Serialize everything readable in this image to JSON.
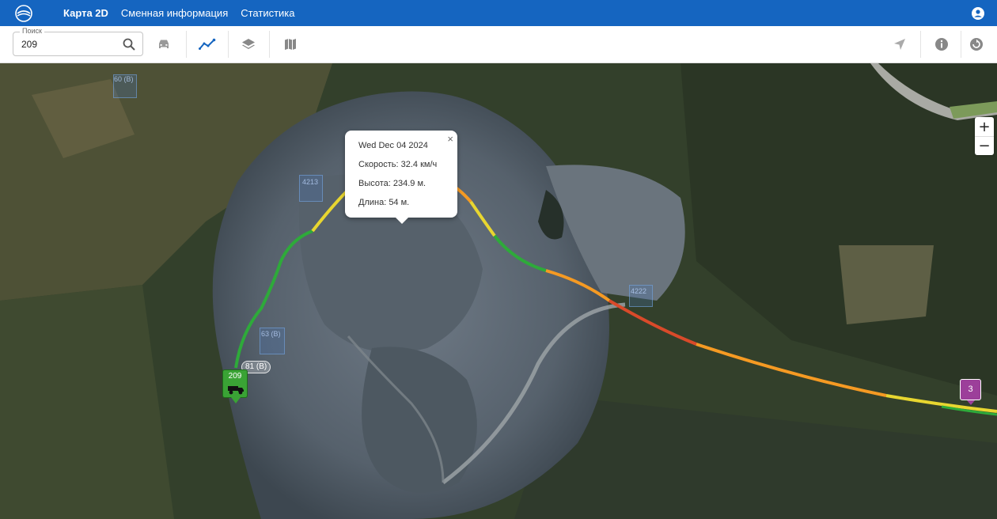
{
  "nav": {
    "items": [
      {
        "label": "Карта 2D",
        "active": true
      },
      {
        "label": "Сменная информация",
        "active": false
      },
      {
        "label": "Статистика",
        "active": false
      }
    ]
  },
  "search": {
    "label": "Поиск",
    "value": "209"
  },
  "toolbar": {
    "icons": [
      "car-icon",
      "route-icon",
      "layers-icon",
      "map-icon",
      "navigation-icon",
      "info-icon",
      "refresh-icon"
    ]
  },
  "zoom": {
    "in": "+",
    "out": "−"
  },
  "popup": {
    "date": "Wed Dec 04 2024",
    "speed": "Скорость: 32.4 км/ч",
    "height": "Высота: 234.9 м.",
    "length": "Длина: 54 м.",
    "close": "×"
  },
  "vehicle": {
    "label": "209"
  },
  "markers": {
    "stop_label": "81 (В)",
    "purple_label": "3",
    "faint_labels": [
      "60 (В)",
      "4213",
      "63 (В)",
      "4222"
    ]
  },
  "colors": {
    "brand": "#1565c0",
    "track_green": "#2eaa3a",
    "track_yellow": "#e8d630",
    "track_orange": "#f59a23",
    "track_red": "#d94a2a",
    "vehicle": "#3aa335",
    "marker_purple": "#9c3f9a"
  }
}
